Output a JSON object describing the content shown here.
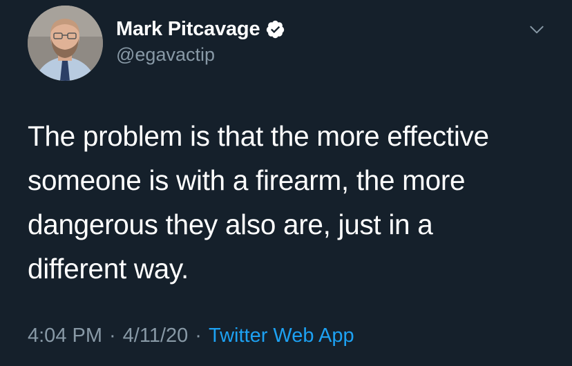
{
  "author": {
    "display_name": "Mark Pitcavage",
    "handle": "@egavactip",
    "verified": true,
    "avatar_icon": "profile-photo"
  },
  "tweet": {
    "text": "The problem is that the more effective\nsomeone is with a firearm, the more\ndangerous they also are, just in a\ndifferent way."
  },
  "meta": {
    "time": "4:04 PM",
    "separator": "·",
    "date": "4/11/20",
    "source": "Twitter Web App"
  },
  "colors": {
    "background": "#15202b",
    "text": "#ffffff",
    "secondary": "#8899a6",
    "accent": "#1da1f2"
  },
  "icons": {
    "verified": "verified-badge-icon",
    "menu": "chevron-down-icon"
  }
}
